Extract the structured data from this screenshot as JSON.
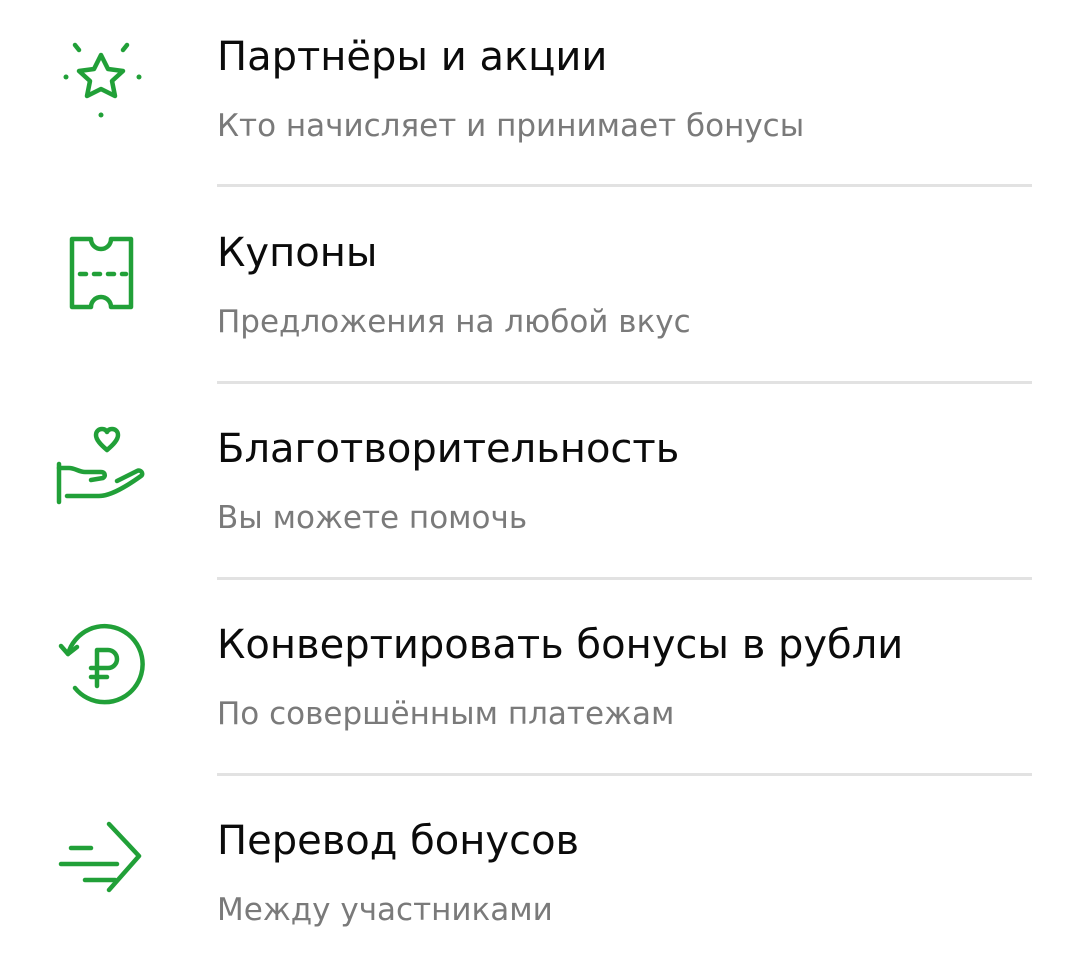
{
  "accent_color": "#21a038",
  "menu": {
    "items": [
      {
        "title": "Партнёры и акции",
        "subtitle": "Кто начисляет и принимает бонусы",
        "icon": "star-sparkle-icon"
      },
      {
        "title": "Купоны",
        "subtitle": "Предложения на любой вкус",
        "icon": "coupon-icon"
      },
      {
        "title": "Благотворительность",
        "subtitle": "Вы можете помочь",
        "icon": "heart-hand-icon"
      },
      {
        "title": "Конвертировать бонусы в рубли",
        "subtitle": "По совершённым платежам",
        "icon": "ruble-convert-icon"
      },
      {
        "title": "Перевод бонусов",
        "subtitle": "Между участниками",
        "icon": "transfer-arrow-icon"
      }
    ]
  }
}
